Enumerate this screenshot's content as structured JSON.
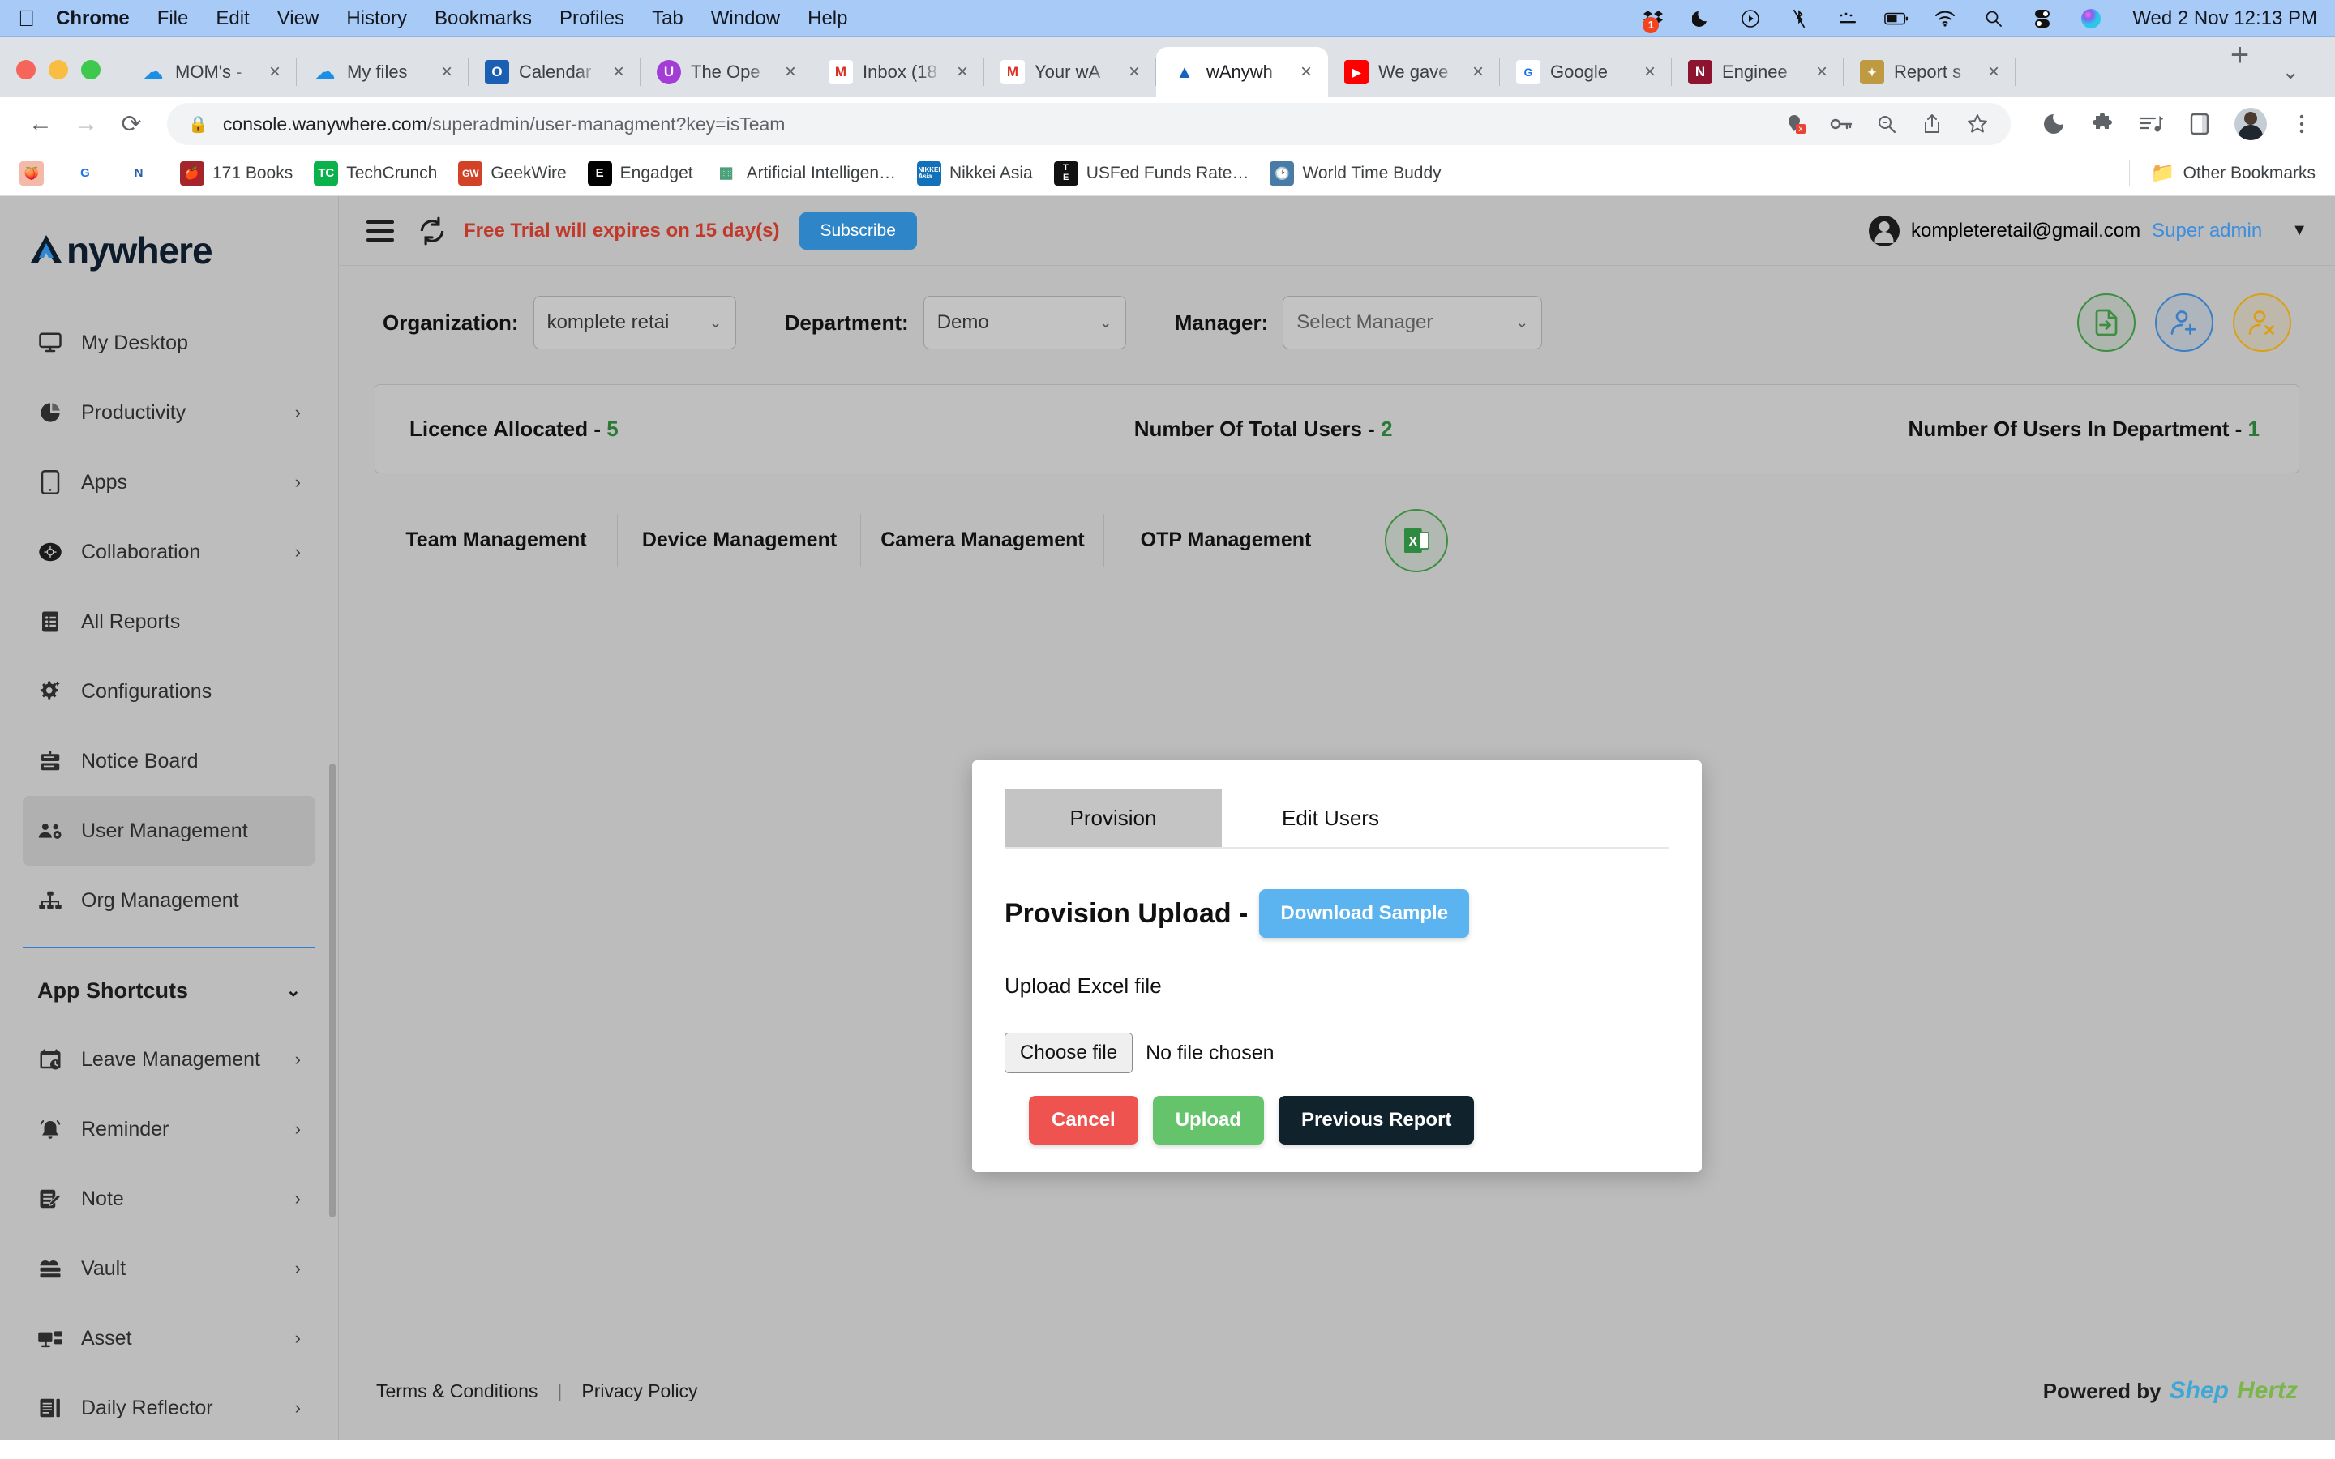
{
  "macos": {
    "apple_icon": "apple-icon",
    "menus": [
      "Chrome",
      "File",
      "Edit",
      "View",
      "History",
      "Bookmarks",
      "Profiles",
      "Tab",
      "Window",
      "Help"
    ],
    "tray_icons": [
      "dropbox-icon",
      "moon-icon",
      "play-circle-icon",
      "bluetooth-off-icon",
      "keyboard-icon",
      "battery-icon",
      "wifi-icon",
      "search-icon",
      "control-center-icon",
      "siri-icon"
    ],
    "notification_badge": "1",
    "clock": "Wed 2 Nov  12:13 PM"
  },
  "browser": {
    "tabs": [
      {
        "title": "MOM's -",
        "favicon": "onedrive-icon",
        "favicon_color": "#1a8fe3",
        "active": false
      },
      {
        "title": "My files",
        "favicon": "onedrive-icon",
        "favicon_color": "#1a8fe3",
        "active": false
      },
      {
        "title": "Calendar",
        "favicon": "outlook-icon",
        "favicon_color": "#1a5fb4",
        "active": false
      },
      {
        "title": "The Ope",
        "favicon": "openai-icon",
        "favicon_color": "#a33dd6",
        "active": false
      },
      {
        "title": "Inbox (18",
        "favicon": "gmail-icon",
        "favicon_color": "#ffffff",
        "active": false
      },
      {
        "title": "Your wA",
        "favicon": "gmail-icon",
        "favicon_color": "#ffffff",
        "active": false
      },
      {
        "title": "wAnywh",
        "favicon": "wanywhere-icon",
        "favicon_color": "#ffffff",
        "active": true
      },
      {
        "title": "We gave",
        "favicon": "youtube-icon",
        "favicon_color": "#ff0000",
        "active": false
      },
      {
        "title": "Google ",
        "favicon": "google-news-icon",
        "favicon_color": "#ffffff",
        "active": false
      },
      {
        "title": "Enginee",
        "favicon": "notion-icon",
        "favicon_color": "#8d1431",
        "active": false
      },
      {
        "title": "Report s",
        "favicon": "report-icon",
        "favicon_color": "#c09a40",
        "active": false
      }
    ],
    "new_tab_label": "+",
    "tab_list_caret": "⌄",
    "nav": {
      "back": "←",
      "forward": "→",
      "reload": "⟳"
    },
    "omnibox": {
      "lock_icon": "lock-icon",
      "url_bold": "console.wanywhere.com",
      "url_rest": "/superadmin/user-managment?key=isTeam"
    },
    "omni_actions": [
      "location-blocked-icon",
      "password-key-icon",
      "zoom-out-icon",
      "share-icon",
      "bookmark-star-icon"
    ],
    "toolbar_actions": [
      "grammarly-icon",
      "extensions-puzzle-icon",
      "reading-list-music-icon",
      "side-panel-icon",
      "profile-avatar",
      "chrome-menu-icon"
    ],
    "bookmarks": [
      {
        "label": "",
        "icon": "peach-icon",
        "color": "#f4b9a8"
      },
      {
        "label": "",
        "icon": "google-news-icon",
        "color": "#ffffff"
      },
      {
        "label": "",
        "icon": "notion-n-icon",
        "color": "#ffffff"
      },
      {
        "label": "171 Books",
        "icon": "apple-books-icon",
        "color": "#a4252b"
      },
      {
        "label": "TechCrunch",
        "icon": "techcrunch-icon",
        "color": "#0bb14a"
      },
      {
        "label": "GeekWire",
        "icon": "geekwire-icon",
        "color": "#d24226"
      },
      {
        "label": "Engadget",
        "icon": "engadget-icon",
        "color": "#000000"
      },
      {
        "label": "Artificial Intelligen…",
        "icon": "ai-icon",
        "color": "#ffffff"
      },
      {
        "label": "Nikkei Asia",
        "icon": "nikkei-asia-icon",
        "color": "#1271b8"
      },
      {
        "label": "USFed Funds Rate…",
        "icon": "te-icon",
        "color": "#111111"
      },
      {
        "label": "World Time Buddy",
        "icon": "world-time-buddy-icon",
        "color": "#4a7ba7"
      }
    ],
    "other_bookmarks": {
      "label": "Other Bookmarks",
      "icon": "folder-icon"
    }
  },
  "sidebar": {
    "brand": "nywhere",
    "brand_logo": "anywhere-logo-icon",
    "items": [
      {
        "label": "My Desktop",
        "icon": "monitor-icon",
        "caret": "",
        "active": false
      },
      {
        "label": "Productivity",
        "icon": "pie-chart-icon",
        "caret": "›",
        "active": false
      },
      {
        "label": "Apps",
        "icon": "tablet-icon",
        "caret": "›",
        "active": false
      },
      {
        "label": "Collaboration",
        "icon": "collaboration-icon",
        "caret": "›",
        "active": false
      },
      {
        "label": "All Reports",
        "icon": "clipboard-list-icon",
        "caret": "",
        "active": false
      },
      {
        "label": "Configurations",
        "icon": "gear-sparkle-icon",
        "caret": "",
        "active": false
      },
      {
        "label": "Notice Board",
        "icon": "notice-board-icon",
        "caret": "",
        "active": false
      },
      {
        "label": "User Management",
        "icon": "users-gear-icon",
        "caret": "",
        "active": true
      },
      {
        "label": "Org Management",
        "icon": "org-chart-icon",
        "caret": "",
        "active": false
      }
    ],
    "section": {
      "label": "App Shortcuts",
      "caret": "⌄"
    },
    "shortcuts": [
      {
        "label": "Leave Management",
        "icon": "calendar-clock-icon",
        "caret": "›"
      },
      {
        "label": "Reminder",
        "icon": "bell-ring-icon",
        "caret": "›"
      },
      {
        "label": "Note",
        "icon": "note-edit-icon",
        "caret": "›"
      },
      {
        "label": "Vault",
        "icon": "vault-icon",
        "caret": "›"
      },
      {
        "label": "Asset",
        "icon": "asset-monitor-icon",
        "caret": "›"
      },
      {
        "label": "Daily Reflector",
        "icon": "daily-reflector-icon",
        "caret": "›"
      }
    ]
  },
  "app_header": {
    "menu_icon": "hamburger-menu-icon",
    "refresh_icon": "refresh-icon",
    "trial_text": "Free Trial will expires on 15 day(s)",
    "subscribe_label": "Subscribe",
    "account_icon": "account-circle-icon",
    "email": "kompleteretail@gmail.com",
    "role": "Super admin",
    "caret": "▼"
  },
  "filters": {
    "organization": {
      "label": "Organization:",
      "value": "komplete retai",
      "caret": "⌄"
    },
    "department": {
      "label": "Department:",
      "value": "Demo",
      "caret": "⌄"
    },
    "manager": {
      "label": "Manager:",
      "value": "Select Manager",
      "caret": "⌄"
    },
    "actions": [
      {
        "name": "import-file-button",
        "icon": "file-import-icon",
        "color": "#3e8e41"
      },
      {
        "name": "add-user-button",
        "icon": "user-add-icon",
        "color": "#3b7fc4"
      },
      {
        "name": "remove-user-button",
        "icon": "user-remove-icon",
        "color": "#d9a017"
      }
    ]
  },
  "stats": [
    {
      "label": "Licence Allocated - ",
      "value": "5"
    },
    {
      "label": "Number Of Total Users - ",
      "value": "2"
    },
    {
      "label": "Number Of Users In Department - ",
      "value": "1"
    }
  ],
  "main_tabs": [
    {
      "label": "Team Management"
    },
    {
      "label": "Device Management"
    },
    {
      "label": "Camera Management"
    },
    {
      "label": "OTP Management"
    }
  ],
  "excel_export": {
    "icon": "excel-export-icon",
    "color": "#3e8e41"
  },
  "modal": {
    "tabs": [
      {
        "label": "Provision",
        "active": true
      },
      {
        "label": "Edit Users",
        "active": false
      }
    ],
    "title": "Provision Upload -",
    "download_sample_label": "Download Sample",
    "upload_label": "Upload Excel file",
    "file_input": {
      "button_label": "Choose file",
      "status": "No file chosen"
    },
    "buttons": [
      {
        "label": "Cancel",
        "style": "cancel"
      },
      {
        "label": "Upload",
        "style": "upload"
      },
      {
        "label": "Previous Report",
        "style": "prev"
      }
    ]
  },
  "footer": {
    "terms": "Terms & Conditions",
    "divider": "|",
    "privacy": "Privacy Policy",
    "powered_by": "Powered by",
    "brand_part1": "Shep",
    "brand_part2": "Hertz"
  }
}
